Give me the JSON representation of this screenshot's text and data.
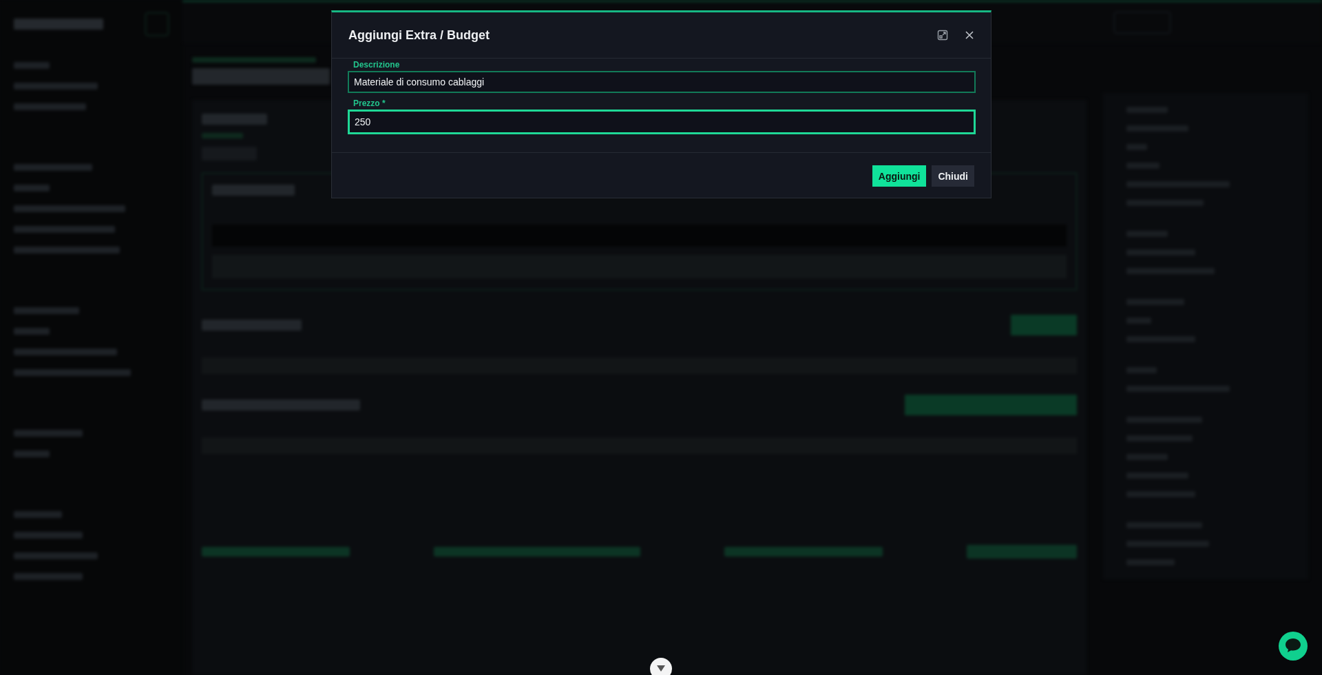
{
  "modal": {
    "title": "Aggiungi Extra / Budget",
    "fields": [
      {
        "label": "Descrizione",
        "value": "Materiale di consumo cablaggi",
        "focused": false
      },
      {
        "label": "Prezzo *",
        "value": "250",
        "focused": true
      }
    ],
    "buttons": [
      {
        "label": "Aggiungi",
        "kind": "primary"
      },
      {
        "label": "Chiudi",
        "kind": "secondary"
      }
    ]
  }
}
